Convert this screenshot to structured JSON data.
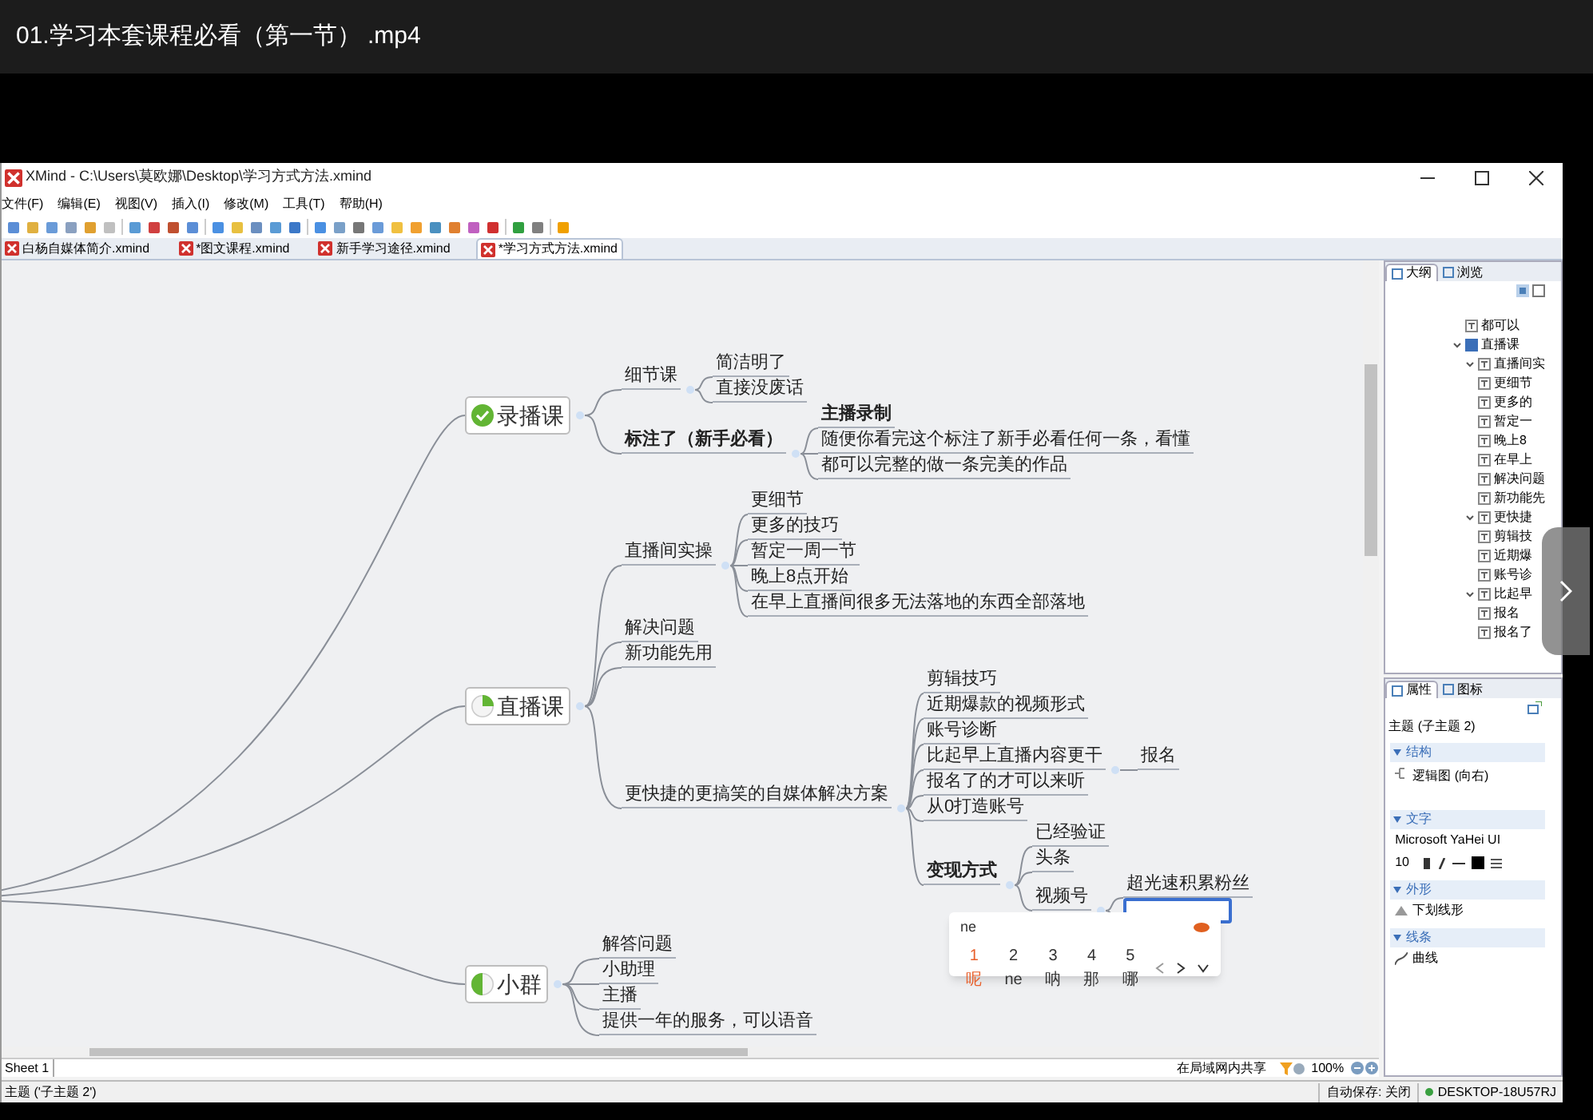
{
  "player": {
    "title": "01.学习本套课程必看（第一节） .mp4"
  },
  "window": {
    "title": "XMind - C:\\Users\\莫欧娜\\Desktop\\学习方式方法.xmind"
  },
  "menu": [
    "文件(F)",
    "编辑(E)",
    "视图(V)",
    "插入(I)",
    "修改(M)",
    "工具(T)",
    "帮助(H)"
  ],
  "tabs": [
    {
      "label": "白杨自媒体简介.xmind",
      "selected": false
    },
    {
      "label": "*图文课程.xmind",
      "selected": false
    },
    {
      "label": "新手学习途径.xmind",
      "selected": false
    },
    {
      "label": "*学习方式方法.xmind",
      "selected": true
    }
  ],
  "map": {
    "topics": [
      {
        "label": "录播课",
        "marker": {
          "kind": "done"
        },
        "children": [
          {
            "label": "细节课",
            "bold": false,
            "children": [
              {
                "label": "简洁明了",
                "bold": false
              },
              {
                "label": "直接没废话",
                "bold": false
              }
            ]
          },
          {
            "label": "标注了（新手必看）",
            "bold": true,
            "children": [
              {
                "label": "主播录制",
                "bold": true
              },
              {
                "label": "随便你看完这个标注了新手必看任何一条，看懂",
                "bold": false
              },
              {
                "label": "都可以完整的做一条完美的作品",
                "bold": false
              }
            ]
          }
        ]
      },
      {
        "label": "直播课",
        "marker": {
          "kind": "quarter"
        },
        "children": [
          {
            "label": "直播间实操",
            "bold": false,
            "children": [
              {
                "label": "更细节",
                "bold": false
              },
              {
                "label": "更多的技巧",
                "bold": false
              },
              {
                "label": "暂定一周一节",
                "bold": false
              },
              {
                "label": "晚上8点开始",
                "bold": false
              },
              {
                "label": "在早上直播间很多无法落地的东西全部落地",
                "bold": false
              }
            ]
          },
          {
            "label": "解决问题",
            "bold": false
          },
          {
            "label": "新功能先用",
            "bold": false
          },
          {
            "label": "更快捷的更搞笑的自媒体解决方案",
            "bold": false,
            "children": [
              {
                "label": "剪辑技巧",
                "bold": false
              },
              {
                "label": "近期爆款的视频形式",
                "bold": false
              },
              {
                "label": "账号诊断",
                "bold": false
              },
              {
                "label": "比起早上直播内容更干",
                "bold": false,
                "children": [
                  {
                    "label": "报名",
                    "bold": false
                  }
                ]
              },
              {
                "label": "报名了的才可以来听",
                "bold": false
              },
              {
                "label": "从0打造账号",
                "bold": false
              },
              {
                "label": "变现方式",
                "bold": true,
                "children": [
                  {
                    "label": "已经验证",
                    "bold": false
                  },
                  {
                    "label": "头条",
                    "bold": false
                  },
                  {
                    "label": "视频号",
                    "bold": false,
                    "children": [
                      {
                        "label": "超光速积累粉丝",
                        "bold": false
                      },
                      {
                        "kind": "editing"
                      }
                    ]
                  }
                ]
              }
            ]
          }
        ]
      },
      {
        "label": "小群",
        "marker": {
          "kind": "half"
        },
        "children": [
          {
            "label": "解答问题",
            "bold": false
          },
          {
            "label": "小助理",
            "bold": false
          },
          {
            "label": "主播",
            "bold": false
          },
          {
            "label": "提供一年的服务，可以语音",
            "bold": false
          }
        ]
      }
    ]
  },
  "ime": {
    "input": "ne",
    "candidates": [
      {
        "label": "1 呢",
        "selected": true
      },
      {
        "label": "2 ne",
        "selected": false
      },
      {
        "label": "3 呐",
        "selected": false
      },
      {
        "label": "4 那",
        "selected": false
      },
      {
        "label": "5 哪",
        "selected": false
      }
    ]
  },
  "sheet_bar": {
    "sheets": [
      {
        "label": "Sheet 1",
        "selected": true
      }
    ],
    "share": "在局域网内共享",
    "zoom": "100%"
  },
  "status_bar": {
    "selection": "主题 ('子主题 2')",
    "autosave": "自动保存: 关闭",
    "computer": "DESKTOP-18U57RJ"
  },
  "outline": {
    "tabs": [
      {
        "label": "大纲",
        "selected": true
      },
      {
        "label": "浏览",
        "selected": false
      }
    ],
    "items": [
      {
        "label": "都可以",
        "kind": "topic"
      },
      {
        "label": "直播课",
        "kind": "main",
        "expanded": true,
        "children": [
          {
            "label": "直播间实",
            "kind": "topic",
            "expanded": true,
            "children": [
              {
                "label": "更细节",
                "kind": "topic"
              },
              {
                "label": "更多的",
                "kind": "topic"
              },
              {
                "label": "暂定一",
                "kind": "topic"
              },
              {
                "label": "晚上8",
                "kind": "topic"
              },
              {
                "label": "在早上",
                "kind": "topic"
              }
            ]
          },
          {
            "label": "解决问题",
            "kind": "topic"
          },
          {
            "label": "新功能先",
            "kind": "topic"
          },
          {
            "label": "更快捷",
            "kind": "topic",
            "expanded": true,
            "children": [
              {
                "label": "剪辑技",
                "kind": "topic"
              },
              {
                "label": "近期爆",
                "kind": "topic"
              },
              {
                "label": "账号诊",
                "kind": "topic"
              },
              {
                "label": "比起早",
                "kind": "topic",
                "expanded": true,
                "children": [
                  {
                    "label": "报名",
                    "kind": "topic"
                  }
                ]
              },
              {
                "label": "报名了",
                "kind": "topic"
              }
            ]
          }
        ]
      }
    ]
  },
  "properties": {
    "tabs": [
      {
        "label": "属性",
        "selected": true
      },
      {
        "label": "图标",
        "selected": false
      }
    ],
    "subject": "主题 (子主题 2)",
    "sections": [
      {
        "title": "结构",
        "kind": "structure",
        "value": "逻辑图 (向右)"
      },
      {
        "title": "文字",
        "kind": "text",
        "font": "Microsoft YaHei UI",
        "size": "10"
      },
      {
        "title": "外形",
        "kind": "shape",
        "value": "下划线形"
      },
      {
        "title": "线条",
        "kind": "line",
        "value": "曲线"
      }
    ]
  }
}
